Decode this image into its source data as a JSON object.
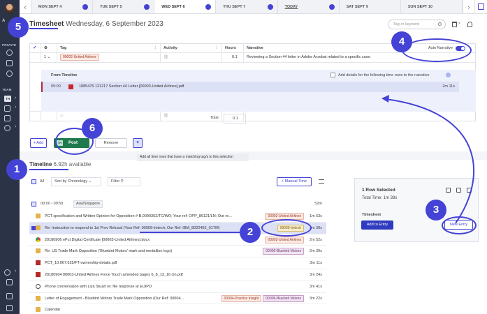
{
  "sidebar": {
    "a_label": "A",
    "private_label": "PRIVATE",
    "team_label": "TEAM",
    "team_badge": "TH"
  },
  "datebar": {
    "tabs": [
      {
        "label": "MON SEPT 4"
      },
      {
        "label": "TUE SEPT 5"
      },
      {
        "label": "WED SEPT 6"
      },
      {
        "label": "THU SEPT 7"
      },
      {
        "label": "TODAY"
      },
      {
        "label": "SAT SEPT 9"
      },
      {
        "label": "SUN SEPT 10"
      }
    ],
    "prev": "‹",
    "next": "›"
  },
  "header": {
    "title": "Timesheet",
    "date": "Wednesday, 6 September 2023"
  },
  "search": {
    "placeholder": "Tag or keyword"
  },
  "grid": {
    "headers": {
      "tag": "Tag",
      "activity": "Activity",
      "hours": "Hours",
      "narrative": "Narrative",
      "auto_narrative": "Auto Narrative"
    },
    "row1": {
      "index": "1",
      "tag": "00002-United Airlines",
      "hours": "0.1",
      "narrative": "Reviewing a Section 44 letter in Adobe Acrobat related to a specific case."
    },
    "from_timeline": {
      "title": "From Timeline",
      "checkbox_label": "Add details for the following time rows to the narrative",
      "entry_time": "09:00",
      "entry_name": "1885475 121217 Section 44 Letter [00003-United Airlines].pdf",
      "entry_duration": "2m 11s"
    },
    "total_label": "Total",
    "total_value": "0.1"
  },
  "actions": {
    "add": "+ Add",
    "post": "Post",
    "post_badge": "TH",
    "remove": "Remove",
    "tooltip": "Add all time rows that have a matching tag/s to this selection"
  },
  "timeline": {
    "title": "Timeline",
    "available": "6.92h available",
    "all_label": "All",
    "sort_label": "Sort by Chronology",
    "filter_label": "Filter",
    "manual_time": "+ Manual Time",
    "group": {
      "range": "09:00 - 09:59",
      "timezone": "Asia/Singapore",
      "duration": "52m"
    },
    "rows": [
      {
        "icon": "folder",
        "title": "PCT specification and Written Opinion for Opposition # B.0090352/TC/WO; Your ref: OPP_86121/LN; Our re...",
        "tags": [
          {
            "label": "00002-United Airlines",
            "color": "red"
          }
        ],
        "duration": "1m 53s",
        "selected": false
      },
      {
        "icon": "folder",
        "title": "Re: Instruction to respond to 1st Prov Refusal (Your Ref: 00009-Initech; Our Ref: IBM_8022455_01TM)",
        "tags": [
          {
            "label": "00009-Initech",
            "color": "yellow"
          }
        ],
        "duration": "1m 38s",
        "selected": true
      },
      {
        "icon": "web",
        "title": "20180906 ePct Digital Certificate [00003-United Airlines].docx",
        "tags": [
          {
            "label": "00002-United Airlines",
            "color": "red"
          }
        ],
        "duration": "2m 52s",
        "selected": false
      },
      {
        "icon": "folder",
        "title": "Re: US Trade Mark Opposition ('Bluebird Motors' mark and medallion logo)",
        "tags": [
          {
            "label": "00006-Bluebird Motors",
            "color": "purple"
          }
        ],
        "duration": "2m 39s",
        "selected": false
      },
      {
        "icon": "pdf",
        "title": "PCT_10.067.625/FT-ownership-details.pdf",
        "tags": [],
        "duration": "3m 11s",
        "selected": false
      },
      {
        "icon": "pdf",
        "title": "20180904 00003-United Airlines Force Touch amended pages 6_8_13_16 cln.pdf",
        "tags": [],
        "duration": "3m 24s",
        "selected": false
      },
      {
        "icon": "clock",
        "title": "Phone conversation with Liza Stuart re: file response at EUIPO",
        "tags": [],
        "duration": "3m 41s",
        "selected": false
      },
      {
        "icon": "folder",
        "title": "Letter of Engagement - Bluebird Motors Trade Mark Opposition (Our Ref: 00004...",
        "tags": [
          {
            "label": "00004-Practice Insight",
            "color": "red"
          },
          {
            "label": "00006-Bluebird Motors",
            "color": "purple"
          }
        ],
        "duration": "3m 22s",
        "selected": false
      },
      {
        "icon": "folder",
        "title": "Calendar",
        "tags": [],
        "duration": "",
        "selected": false
      }
    ]
  },
  "panel": {
    "selected": "1 Row Selected",
    "total": "Total Time: 1m 38s",
    "timesheet_label": "Timesheet",
    "add_to_entry": "Add to Entry",
    "new_entry": "New Entry"
  },
  "callouts": [
    "1",
    "2",
    "3",
    "4",
    "5",
    "6"
  ],
  "colors": {
    "accent": "#4443d6",
    "post_green": "#1f7a4d",
    "sidebar": "#2b3346"
  }
}
